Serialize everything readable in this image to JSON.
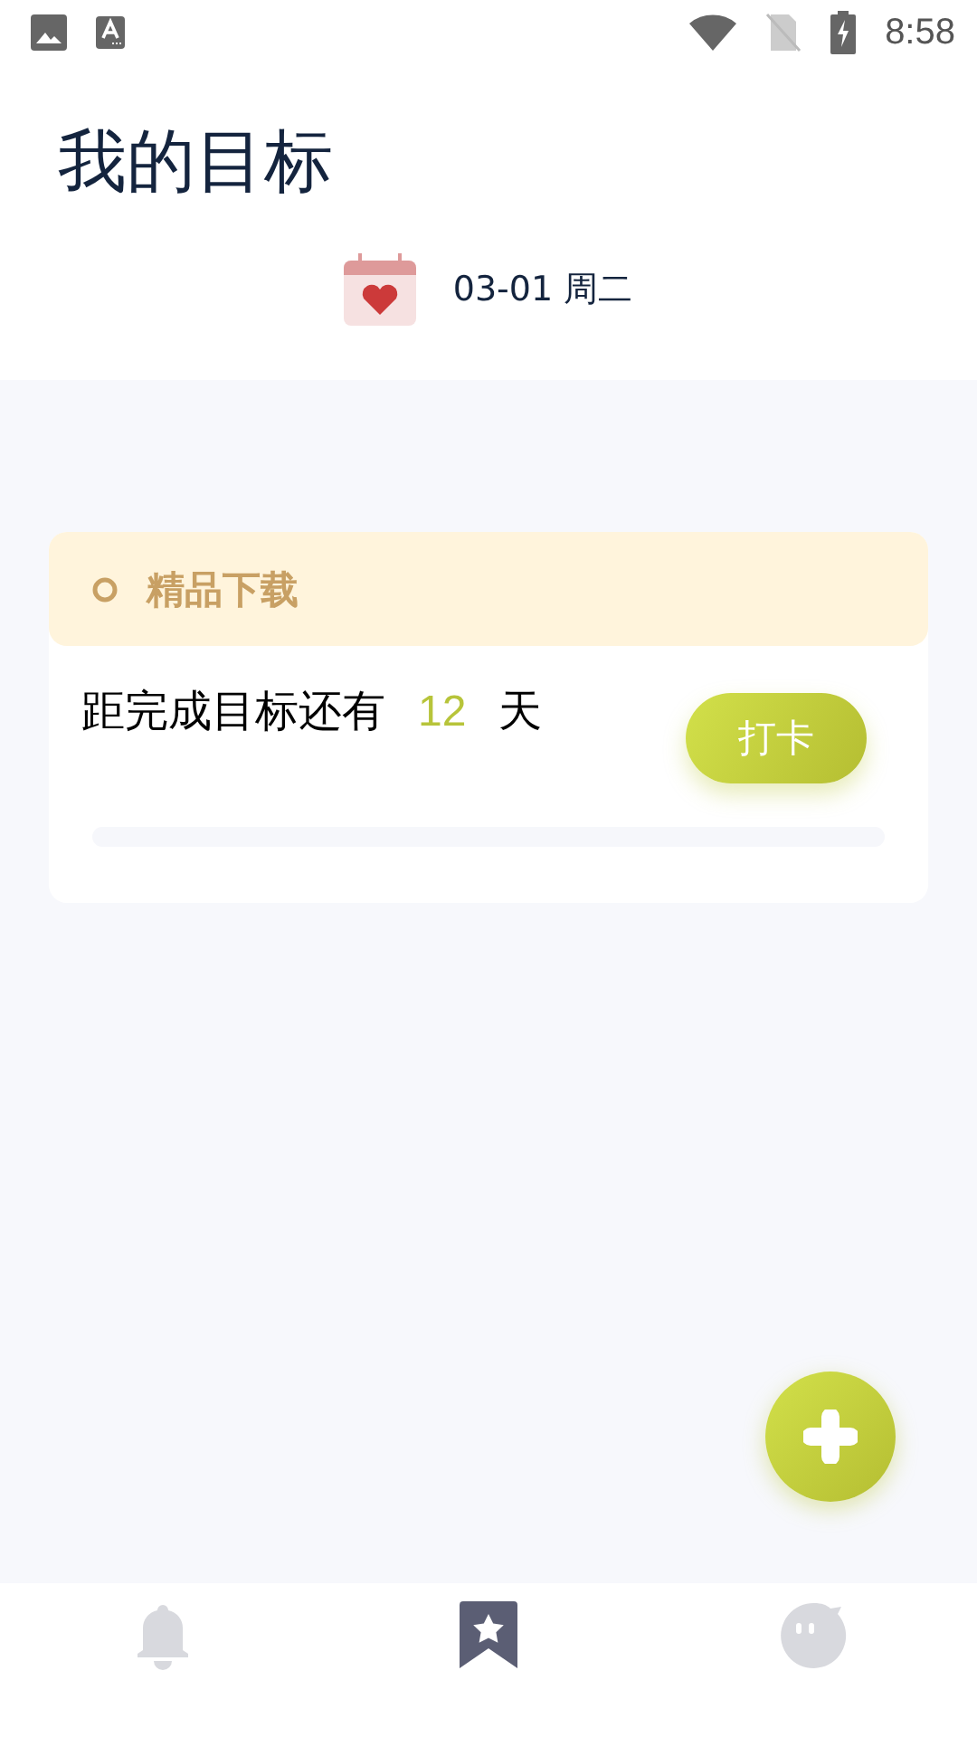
{
  "status_bar": {
    "time": "8:58"
  },
  "header": {
    "title": "我的目标",
    "date": "03-01 周二"
  },
  "goals": [
    {
      "title": "精品下载",
      "prefix": "距完成目标还有",
      "days": "12",
      "suffix": "天",
      "button": "打卡",
      "level": 0
    }
  ],
  "nav": [
    {
      "kind": "bell",
      "selected": false
    },
    {
      "kind": "bookmark",
      "selected": true
    },
    {
      "kind": "face",
      "selected": false
    }
  ]
}
